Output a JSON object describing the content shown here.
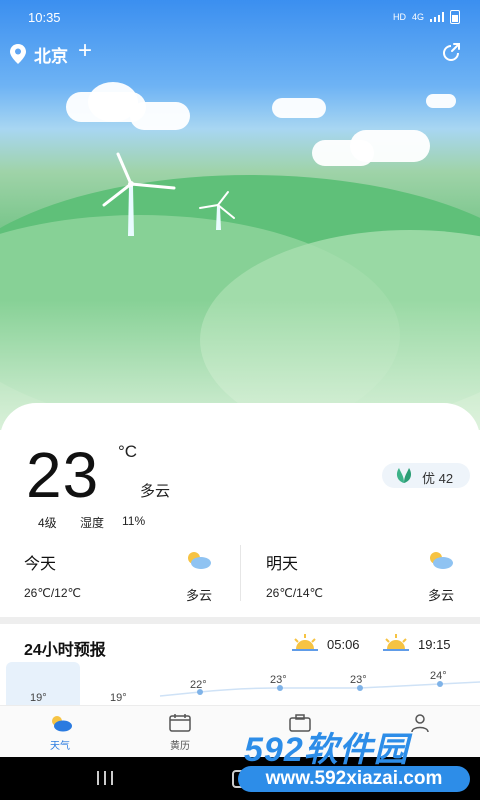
{
  "status_bar": {
    "time": "10:35",
    "indicators": [
      "HD",
      "4G",
      "signal-icon",
      "battery-icon"
    ]
  },
  "header": {
    "city": "北京",
    "add_label": "+",
    "share_icon": "share-icon",
    "location_icon": "location-pin-icon"
  },
  "current": {
    "temperature": "23",
    "unit": "°C",
    "condition": "多云",
    "wind": "4级",
    "humidity_label": "湿度",
    "humidity": "11%",
    "aqi": "优 42"
  },
  "forecast": [
    {
      "day": "今天",
      "temps": "26℃/12℃",
      "condition": "多云",
      "icon": "partly-cloudy-icon"
    },
    {
      "day": "明天",
      "temps": "26℃/14℃",
      "condition": "多云",
      "icon": "partly-cloudy-icon"
    }
  ],
  "hourly": {
    "title": "24小时预报",
    "sunrise": "05:06",
    "sunset": "19:15",
    "temps": [
      "19°",
      "19°",
      "22°",
      "23°",
      "23°",
      "24°"
    ]
  },
  "nav": {
    "items": [
      {
        "label": "天气",
        "icon": "weather-icon",
        "active": true
      },
      {
        "label": "黄历",
        "icon": "calendar-icon",
        "active": false
      },
      {
        "label": "",
        "icon": "briefcase-icon",
        "active": false
      },
      {
        "label": "",
        "icon": "user-icon",
        "active": false
      }
    ]
  },
  "watermark": {
    "brand": "592软件园",
    "url": "www.592xiazai.com"
  },
  "colors": {
    "accent": "#2b7be0",
    "sky": "#3b8ff0",
    "hill": "#5fc079"
  }
}
